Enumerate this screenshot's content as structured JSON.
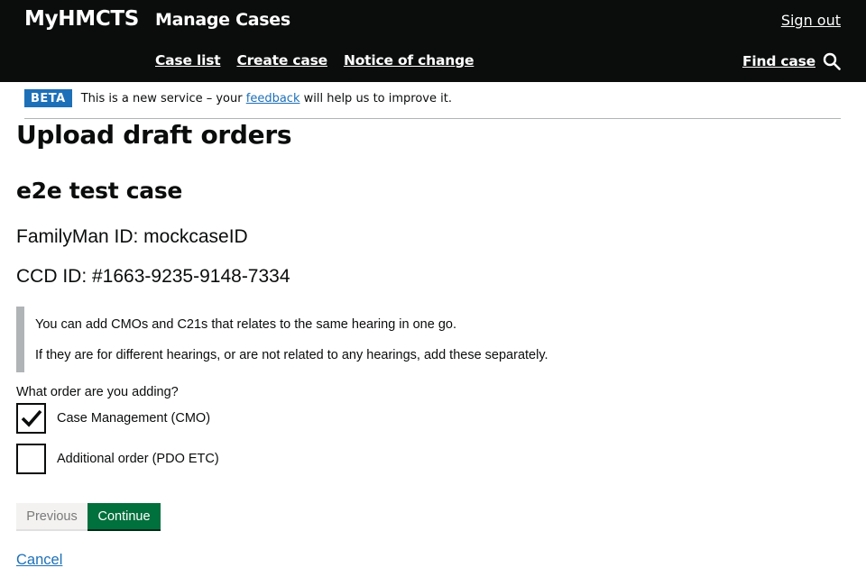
{
  "header": {
    "brand": "MyHMCTS",
    "service": "Manage Cases",
    "sign_out": "Sign out",
    "nav": [
      "Case list",
      "Create case",
      "Notice of change"
    ],
    "find_case": "Find case",
    "icon": "search-icon"
  },
  "beta": {
    "tag": "BETA",
    "text_before": "This is a new service – your",
    "link": "feedback",
    "text_after": "will help us to improve it."
  },
  "page": {
    "heading": "Upload draft orders",
    "case_name": "e2e test case",
    "familyman": "FamilyMan ID: mockcaseID",
    "ccd": "CCD ID: #1663-9235-9148-7334",
    "inset": [
      "You can add CMOs and C21s that relates to the same hearing in one go.",
      "If they are for different hearings, or are not related to any hearings, add these separately."
    ],
    "question": "What order are you adding?",
    "options": [
      {
        "label": "Case Management (CMO)",
        "checked": true
      },
      {
        "label": "Additional order (PDO ETC)",
        "checked": false
      }
    ],
    "previous": "Previous",
    "continue": "Continue",
    "cancel": "Cancel"
  },
  "colors": {
    "header_bg": "#0b0c0c",
    "beta_tag": "#1d70b8",
    "link": "#1d70b8",
    "continue_bg": "#00703c",
    "previous_bg": "#f3f2f1",
    "inset_border": "#b1b4b6"
  }
}
